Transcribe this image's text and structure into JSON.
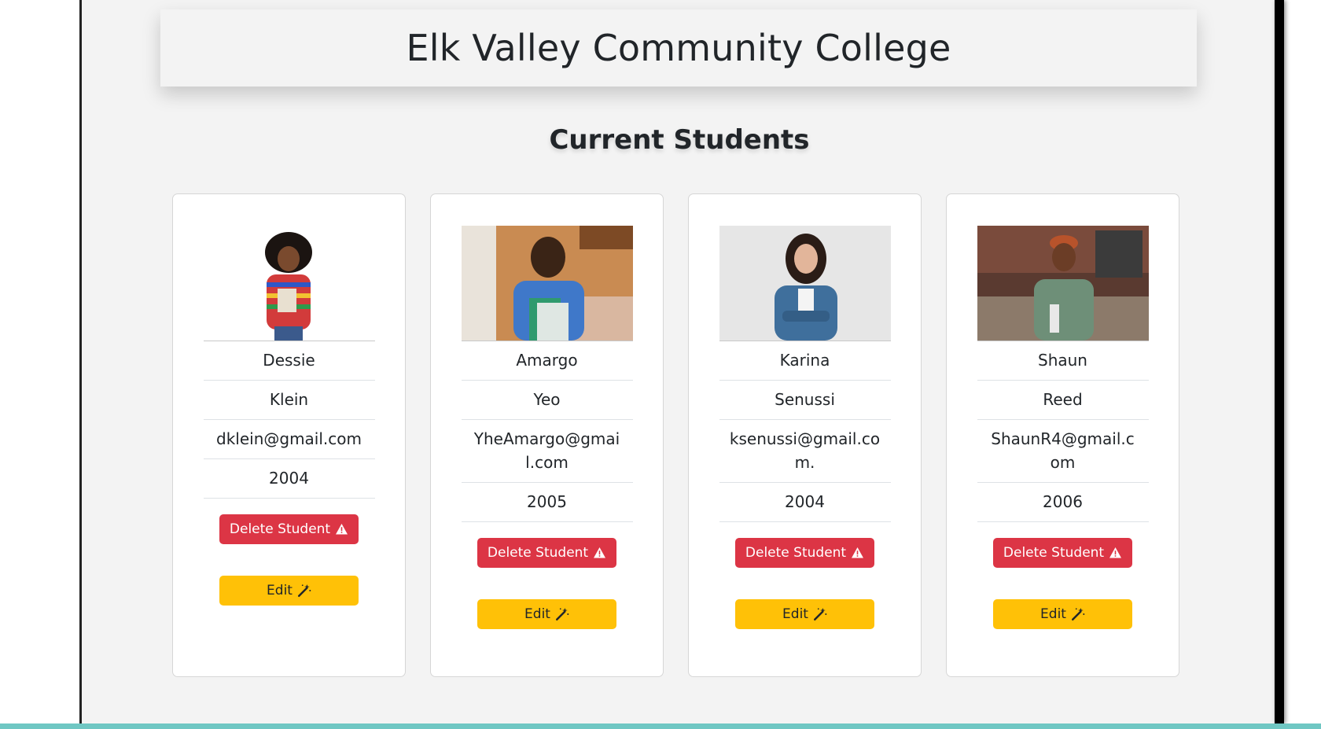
{
  "header": {
    "title": "Elk Valley Community College"
  },
  "section": {
    "title": "Current Students"
  },
  "colors": {
    "page_bg": "#f3f3f3",
    "delete_button": "#dc3545",
    "edit_button": "#ffc107",
    "accent_bottom": "#6fc7c3"
  },
  "students": [
    {
      "first_name": "Dessie",
      "last_name": "Klein",
      "email": "dklein@gmail.com",
      "year": "2004",
      "photo_alt": "student-photo",
      "delete_label": "Delete Student",
      "edit_label": "Edit"
    },
    {
      "first_name": "Amargo",
      "last_name": "Yeo",
      "email": "YheAmargo@gmail.com",
      "year": "2005",
      "photo_alt": "student-photo",
      "delete_label": "Delete Student",
      "edit_label": "Edit"
    },
    {
      "first_name": "Karina",
      "last_name": "Senussi",
      "email": "ksenussi@gmail.com.",
      "year": "2004",
      "photo_alt": "student-photo",
      "delete_label": "Delete Student",
      "edit_label": "Edit"
    },
    {
      "first_name": "Shaun",
      "last_name": "Reed",
      "email": "ShaunR4@gmail.com",
      "year": "2006",
      "photo_alt": "student-photo",
      "delete_label": "Delete Student",
      "edit_label": "Edit"
    }
  ],
  "icons": {
    "delete": "warning-triangle-icon",
    "edit": "magic-wand-icon"
  }
}
